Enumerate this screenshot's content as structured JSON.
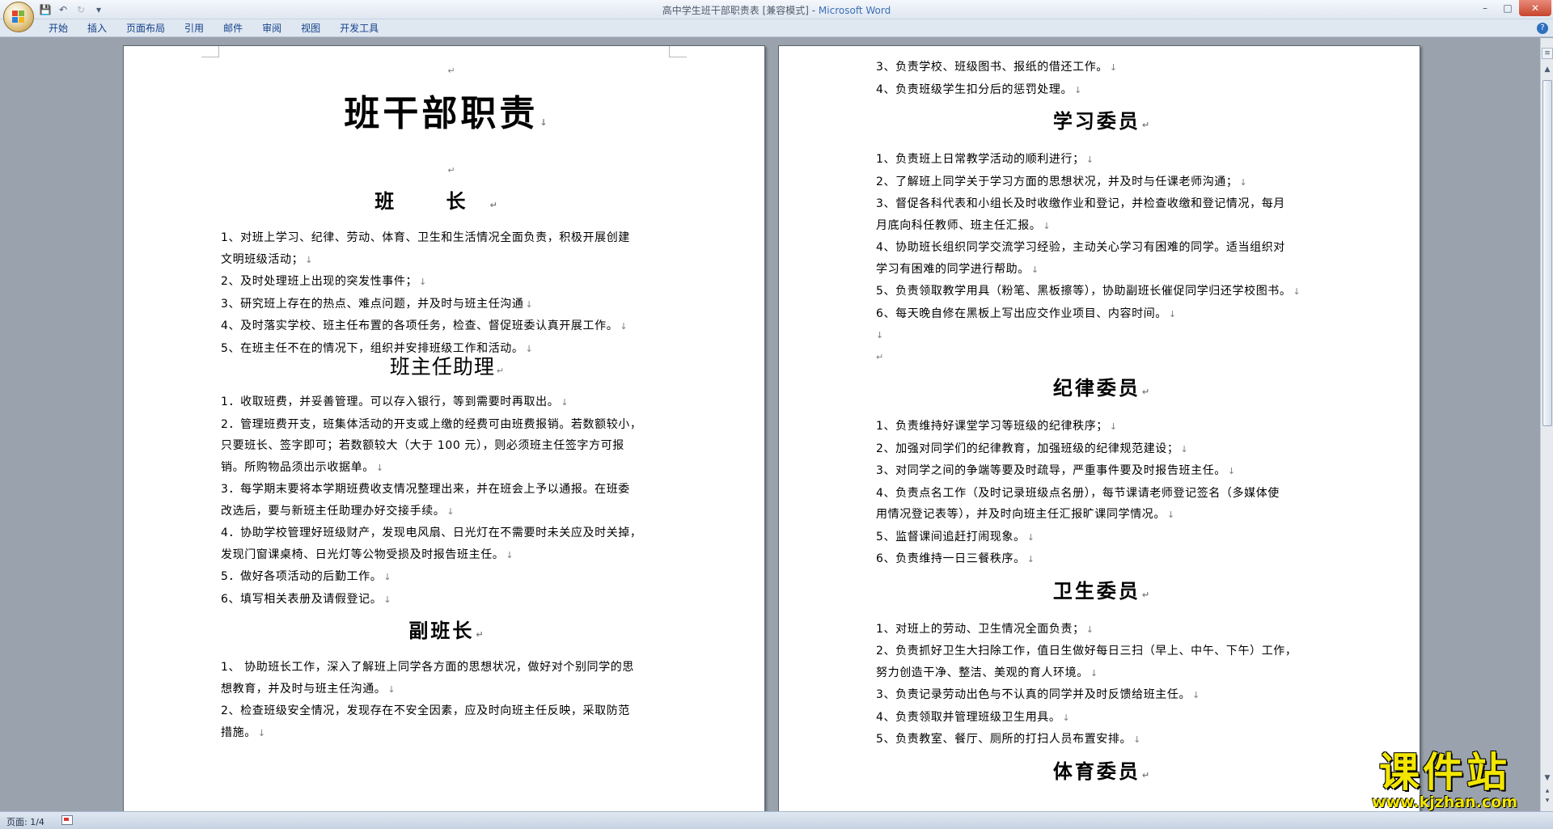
{
  "window": {
    "title": "高中学生班干部职责表 [兼容模式] - ",
    "app_name": "Microsoft Word"
  },
  "ribbon_tabs": [
    "开始",
    "插入",
    "页面布局",
    "引用",
    "邮件",
    "审阅",
    "视图",
    "开发工具"
  ],
  "status": {
    "pages": "页面: 1/4"
  },
  "left_page": {
    "title": "班干部职责",
    "sections": [
      {
        "heading": "班  长",
        "items": [
          [
            "1、对班上学习、纪律、劳动、体育、卫生和生活情况全面负责，积极开展创建",
            "文明班级活动；"
          ],
          [
            "2、及时处理班上出现的突发性事件；"
          ],
          [
            "3、研究班上存在的热点、难点问题，并及时与班主任沟通"
          ],
          [
            "4、及时落实学校、班主任布置的各项任务，检查、督促班委认真开展工作。"
          ],
          [
            "5、在班主任不在的情况下，组织并安排班级工作和活动。"
          ]
        ]
      },
      {
        "heading": "班主任助理",
        "items": [
          [
            "1．收取班费，并妥善管理。可以存入银行，等到需要时再取出。"
          ],
          [
            "2．管理班费开支，班集体活动的开支或上缴的经费可由班费报销。若数额较小，",
            "只要班长、签字即可；若数额较大（大于 100 元），则必须班主任签字方可报",
            "销。所购物品须出示收据单。"
          ],
          [
            "3．每学期末要将本学期班费收支情况整理出来，并在班会上予以通报。在班委",
            "改选后，要与新班主任助理办好交接手续。"
          ],
          [
            "4．协助学校管理好班级财产，发现电风扇、日光灯在不需要时未关应及时关掉，",
            "发现门窗课桌椅、日光灯等公物受损及时报告班主任。"
          ],
          [
            "5．做好各项活动的后勤工作。"
          ],
          [
            "6、填写相关表册及请假登记。"
          ]
        ]
      },
      {
        "heading": "副班长",
        "items": [
          [
            "1、 协助班长工作，深入了解班上同学各方面的思想状况，做好对个别同学的思",
            "想教育，并及时与班主任沟通。"
          ],
          [
            "2、检查班级安全情况，发现存在不安全因素，应及时向班主任反映，采取防范",
            "措施。"
          ]
        ]
      }
    ]
  },
  "right_page": {
    "top_items": [
      [
        "3、负责学校、班级图书、报纸的借还工作。"
      ],
      [
        "4、负责班级学生扣分后的惩罚处理。"
      ]
    ],
    "sections": [
      {
        "heading": "学习委员",
        "items": [
          [
            "1、负责班上日常教学活动的顺利进行；"
          ],
          [
            "2、了解班上同学关于学习方面的思想状况，并及时与任课老师沟通；"
          ],
          [
            "3、督促各科代表和小组长及时收缴作业和登记，并检查收缴和登记情况，每月",
            "月底向科任教师、班主任汇报。"
          ],
          [
            "4、协助班长组织同学交流学习经验，主动关心学习有困难的同学。适当组织对",
            "学习有困难的同学进行帮助。"
          ],
          [
            "5、负责领取教学用具（粉笔、黑板擦等），协助副班长催促同学归还学校图书。"
          ],
          [
            "6、每天晚自修在黑板上写出应交作业项目、内容时间。"
          ]
        ]
      },
      {
        "heading": "纪律委员",
        "items": [
          [
            "1、负责维持好课堂学习等班级的纪律秩序；"
          ],
          [
            "2、加强对同学们的纪律教育，加强班级的纪律规范建设；"
          ],
          [
            "3、对同学之间的争端等要及时疏导，严重事件要及时报告班主任。"
          ],
          [
            "4、负责点名工作（及时记录班级点名册），每节课请老师登记签名（多媒体使",
            "用情况登记表等），并及时向班主任汇报旷课同学情况。"
          ],
          [
            "5、监督课间追赶打闹现象。"
          ],
          [
            "6、负责维持一日三餐秩序。"
          ]
        ]
      },
      {
        "heading": "卫生委员",
        "items": [
          [
            "1、对班上的劳动、卫生情况全面负责；"
          ],
          [
            "2、负责抓好卫生大扫除工作，值日生做好每日三扫（早上、中午、下午）工作，",
            "努力创造干净、整洁、美观的育人环境。"
          ],
          [
            "3、负责记录劳动出色与不认真的同学并及时反馈给班主任。"
          ],
          [
            "4、负责领取并管理班级卫生用具。"
          ],
          [
            "5、负责教室、餐厅、厕所的打扫人员布置安排。"
          ]
        ]
      },
      {
        "heading": "体育委员",
        "items": []
      }
    ]
  },
  "watermark": {
    "main": "课件站",
    "url": "www.kjzhan.com"
  },
  "colors": {
    "ribbon_text": "#15428b",
    "page_bg": "#ffffff",
    "workspace_bg": "#9aa3ad",
    "watermark": "#f2e600"
  }
}
